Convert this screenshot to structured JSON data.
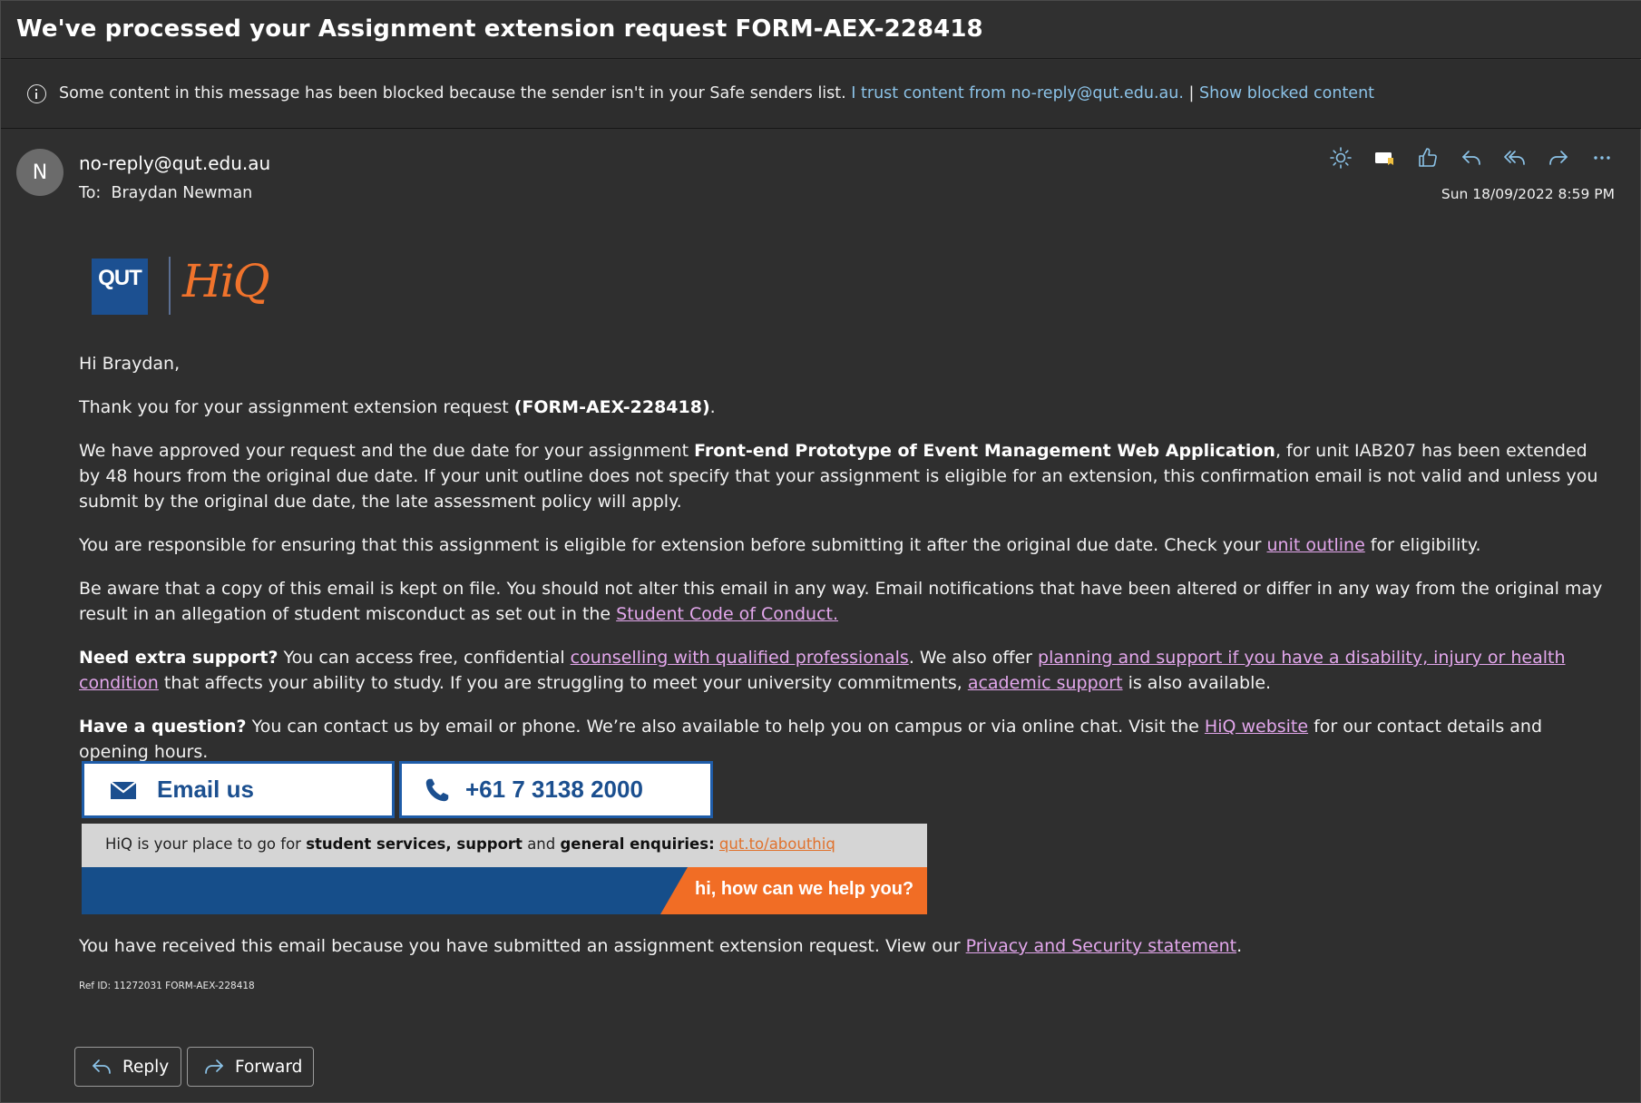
{
  "email": {
    "subject": "We've processed your Assignment extension request FORM-AEX-228418",
    "blocked_notice": {
      "message": "Some content in this message has been blocked because the sender isn't in your Safe senders list.",
      "trust_link": "I trust content from no-reply@qut.edu.au.",
      "separator": "|",
      "show_link": "Show blocked content"
    },
    "sender": {
      "avatar_initial": "N",
      "address": "no-reply@qut.edu.au",
      "to_label": "To:",
      "to_name": "Braydan Newman",
      "date": "Sun 18/09/2022 8:59 PM"
    },
    "actions": [
      {
        "name": "brightness",
        "icon": "sun-icon"
      },
      {
        "name": "categorize",
        "icon": "tag-icon"
      },
      {
        "name": "like",
        "icon": "thumbs-up-icon"
      },
      {
        "name": "reply",
        "icon": "reply-icon"
      },
      {
        "name": "reply-all",
        "icon": "reply-all-icon"
      },
      {
        "name": "forward",
        "icon": "forward-icon"
      },
      {
        "name": "more",
        "icon": "more-icon"
      }
    ],
    "logo": {
      "left": "QUT",
      "right": "HiQ"
    },
    "body": {
      "greeting": "Hi Braydan,",
      "p1_a": "Thank you for your assignment extension request ",
      "p1_bold": "(FORM-AEX-228418)",
      "p1_b": ".",
      "p2_a": "We have approved your request and the due date for your assignment ",
      "p2_bold": "Front-end Prototype of Event Management Web Application",
      "p2_b": ", for unit IAB207 has been extended by 48 hours from the original due date. If your unit outline does not specify that your assignment is eligible for an extension, this confirmation email is not valid and unless you submit by the original due date, the late assessment policy will apply.",
      "p3_a": "You are responsible for ensuring that this assignment is eligible for extension before submitting it after the original due date. Check your ",
      "p3_link": "unit outline",
      "p3_b": " for eligibility.",
      "p4_a": "Be aware that a copy of this email is kept on file. You should not alter this email in any way. Email notifications that have been altered or differ in any way from the original may result in an allegation of student misconduct as set out in the ",
      "p4_link": "Student Code of Conduct.",
      "p5_bold": "Need extra support?",
      "p5_a": " You can access free, confidential ",
      "p5_link1": "counselling with qualified professionals",
      "p5_b": ". We also offer ",
      "p5_link2": "planning and support if you have a disability, injury or health condition",
      "p5_c": " that affects your ability to study. If you are struggling to meet your university commitments, ",
      "p5_link3": "academic support",
      "p5_d": " is also available.",
      "p6_bold": "Have a question?",
      "p6_a": " You can contact us by email or phone. We’re also available to help you on campus or via online chat. Visit the ",
      "p6_link": "HiQ website",
      "p6_b": " for our contact details and opening hours."
    },
    "contact": {
      "email_label": "Email us",
      "phone_label": "+61 7 3138 2000"
    },
    "banner": {
      "text_a": "HiQ is your place to go for ",
      "bold1": "student services, support",
      "text_b": " and ",
      "bold2": "general enquiries:",
      "text_c": " ",
      "link": "qut.to/abouthiq",
      "tagline": "hi, how can we help you?",
      "colors": {
        "blue": "#164e8a",
        "orange": "#f16d25",
        "grey": "#d5d5d5"
      }
    },
    "footer": {
      "note_a": "You have received this email because you have submitted an assignment extension request. View our ",
      "note_link": "Privacy and Security statement",
      "note_b": ".",
      "ref": "Ref ID: 11272031 FORM-AEX-228418"
    },
    "reply_buttons": {
      "reply": "Reply",
      "forward": "Forward"
    }
  }
}
